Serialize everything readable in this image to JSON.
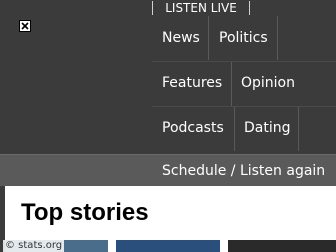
{
  "topbar": {
    "listen_live_label": "LISTEN LIVE"
  },
  "nav": {
    "rows": [
      [
        {
          "label": "News"
        },
        {
          "label": "Politics"
        }
      ],
      [
        {
          "label": "Features"
        },
        {
          "label": "Opinion"
        }
      ],
      [
        {
          "label": "Podcasts"
        },
        {
          "label": "Dating"
        }
      ]
    ],
    "schedule_label": "Schedule / Listen again"
  },
  "main": {
    "section_title": "Top stories"
  },
  "watermark": "© stats.org",
  "colors": {
    "background": "#3b3b3b",
    "schedule_bar": "#5a5a5a",
    "content_bg": "#ffffff"
  }
}
